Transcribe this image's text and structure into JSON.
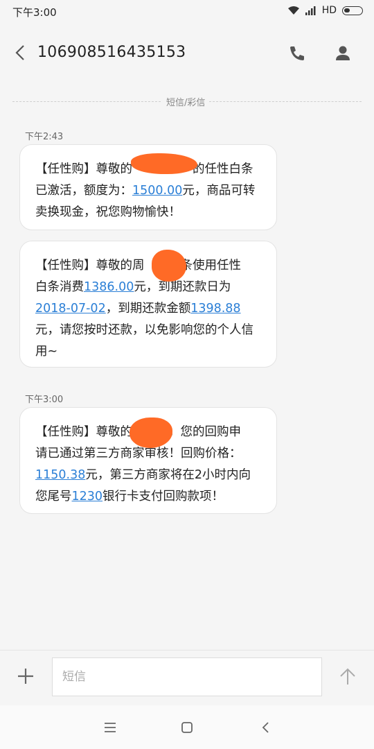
{
  "status_bar": {
    "time": "下午3:00",
    "network": "HD"
  },
  "header": {
    "contact_number": "106908516435153"
  },
  "thread": {
    "type_label": "短信/彩信"
  },
  "messages": [
    {
      "timestamp": "下午2:43",
      "lines": [
        [
          "【任性购】尊敬的",
          "的任性白条"
        ],
        [
          "已激活，额度为：",
          "1500.00",
          "元，商品可转"
        ],
        [
          "卖换现金，祝您购物愉快！"
        ]
      ]
    },
    {
      "lines": [
        [
          "【任性购】尊敬的周",
          "条使用任性"
        ],
        [
          "白条消费",
          "1386.00",
          "元，到期还款日为"
        ],
        [
          "2018-07-02",
          "，到期还款金额",
          "1398.88"
        ],
        [
          "元，请您按时还款，以免影响您的个人信"
        ],
        [
          "用~"
        ]
      ]
    },
    {
      "timestamp": "下午3:00",
      "lines": [
        [
          "【任性购】尊敬的",
          "，您的回购申"
        ],
        [
          "请已通过第三方商家审核！回购价格："
        ],
        [
          "1150.38",
          "元，第三方商家将在2小时内向"
        ],
        [
          "您尾号",
          "1230",
          "银行卡支付回购款项！"
        ]
      ]
    }
  ],
  "compose": {
    "placeholder": "短信"
  },
  "colors": {
    "link": "#2b7fd6",
    "redaction": "#ff6a26",
    "background": "#f5f5f5"
  }
}
